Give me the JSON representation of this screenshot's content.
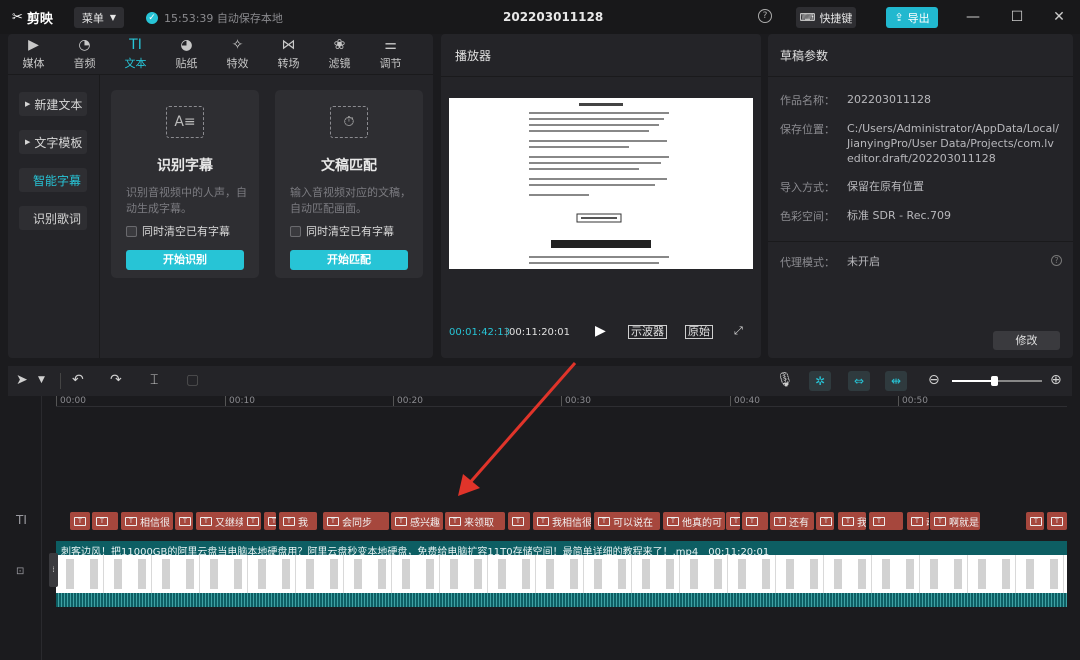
{
  "app": {
    "name": "剪映",
    "menu_label": "菜单",
    "save_status": "15:53:39 自动保存本地",
    "project_title": "202203011128",
    "shortcut_label": "快捷键",
    "export_label": "导出"
  },
  "toolbar_tabs": [
    {
      "label": "媒体",
      "icon": "media-icon"
    },
    {
      "label": "音频",
      "icon": "audio-icon"
    },
    {
      "label": "文本",
      "icon": "text-icon",
      "active": true
    },
    {
      "label": "贴纸",
      "icon": "sticker-icon"
    },
    {
      "label": "特效",
      "icon": "effects-icon"
    },
    {
      "label": "转场",
      "icon": "transition-icon"
    },
    {
      "label": "滤镜",
      "icon": "filter-icon"
    },
    {
      "label": "调节",
      "icon": "adjust-icon"
    }
  ],
  "side_menu": [
    {
      "label": "新建文本",
      "expandable": true
    },
    {
      "label": "文字模板",
      "expandable": true
    },
    {
      "label": "智能字幕",
      "active": true
    },
    {
      "label": "识别歌词"
    }
  ],
  "cards": [
    {
      "title": "识别字幕",
      "desc": "识别音视频中的人声，自动生成字幕。",
      "checkbox": "同时清空已有字幕",
      "button": "开始识别"
    },
    {
      "title": "文稿匹配",
      "desc": "输入音视频对应的文稿，自动匹配画面。",
      "checkbox": "同时清空已有字幕",
      "button": "开始匹配"
    }
  ],
  "player": {
    "title": "播放器",
    "current_time": "00:01:42:13",
    "total_time": "00:11:20:01",
    "scope_label": "示波器",
    "original_label": "原始"
  },
  "draft": {
    "title": "草稿参数",
    "fields": [
      {
        "label": "作品名称：",
        "value": "202203011128"
      },
      {
        "label": "保存位置：",
        "value": "C:/Users/Administrator/AppData/Local/JianyingPro/User Data/Projects/com.lveditor.draft/202203011128"
      },
      {
        "label": "导入方式：",
        "value": "保留在原有位置"
      },
      {
        "label": "色彩空间：",
        "value": "标准 SDR - Rec.709"
      },
      {
        "label": "代理模式：",
        "value": "未开启"
      }
    ],
    "modify_label": "修改"
  },
  "ruler": [
    "00:00",
    "00:10",
    "00:20",
    "00:30",
    "00:40",
    "00:50"
  ],
  "subtitle_clips": [
    {
      "text": ""
    },
    {
      "text": ""
    },
    {
      "text": "相信很"
    },
    {
      "text": ""
    },
    {
      "text": "又继续"
    },
    {
      "text": ""
    },
    {
      "text": ""
    },
    {
      "text": "我"
    },
    {
      "text": "会同步"
    },
    {
      "text": "感兴趣"
    },
    {
      "text": "来领取"
    },
    {
      "text": ""
    },
    {
      "text": "我相信很"
    },
    {
      "text": "可以说在"
    },
    {
      "text": "他真的可"
    },
    {
      "text": ""
    },
    {
      "text": ""
    },
    {
      "text": "还有"
    },
    {
      "text": ""
    },
    {
      "text": "我"
    },
    {
      "text": ""
    },
    {
      "text": "动不"
    },
    {
      "text": "啊就是"
    },
    {
      "text": ""
    },
    {
      "text": ""
    }
  ],
  "video_clip": {
    "name": "刺客边风！把11000GB的阿里云盘当电脑本地硬盘用？阿里云盘秒变本地硬盘，免费给电脑扩容11T0存储空间！最简单详细的教程来了！.mp4",
    "duration": "00:11:20:01"
  },
  "colors": {
    "accent": "#27c4d6",
    "subtitle_clip": "#a6473d",
    "video_track": "#0d5e63",
    "arrow": "#e0342a"
  }
}
